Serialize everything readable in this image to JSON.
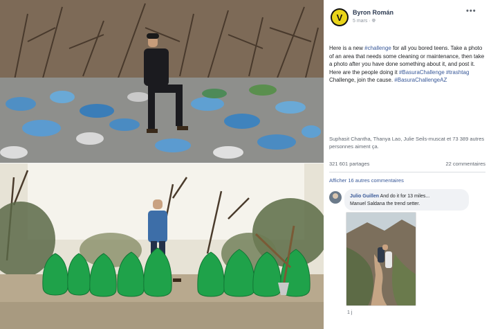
{
  "post": {
    "author": "Byron Román",
    "timestamp": "5 mars",
    "privacy_icon": "globe-icon",
    "more_icon": "more-icon",
    "text_parts": {
      "p1": "Here is a new ",
      "tag1": "#challenge",
      "p2": " for all you bored teens. Take a photo of an area that needs some cleaning or maintenance, then take a photo after you have done something about it, and post it. Here are the people doing it ",
      "tag2": "#BasuraChallenge",
      "p3": " ",
      "tag3": "#trashtag",
      "p4": " Challenge, join the cause. ",
      "tag4": "#BasuraChallengeAZ"
    },
    "likes": "Suphasit Chantha, Thanya Lao, Julie Seils-muscat et 73 389 autres personnes aiment ça.",
    "shares": "321 601 partages",
    "comments_count": "22 commentaires",
    "see_more_comments": "Afficher 16 autres commentaires"
  },
  "comment": {
    "author": "Julio Guillen",
    "text": "And do it for 13 miles...",
    "text2": "Manuel Saldana the trend setter.",
    "footer": "1 j"
  },
  "colors": {
    "link": "#385898",
    "bag_green": "#1fa24a",
    "avatar_yellow": "#e9d41a"
  }
}
